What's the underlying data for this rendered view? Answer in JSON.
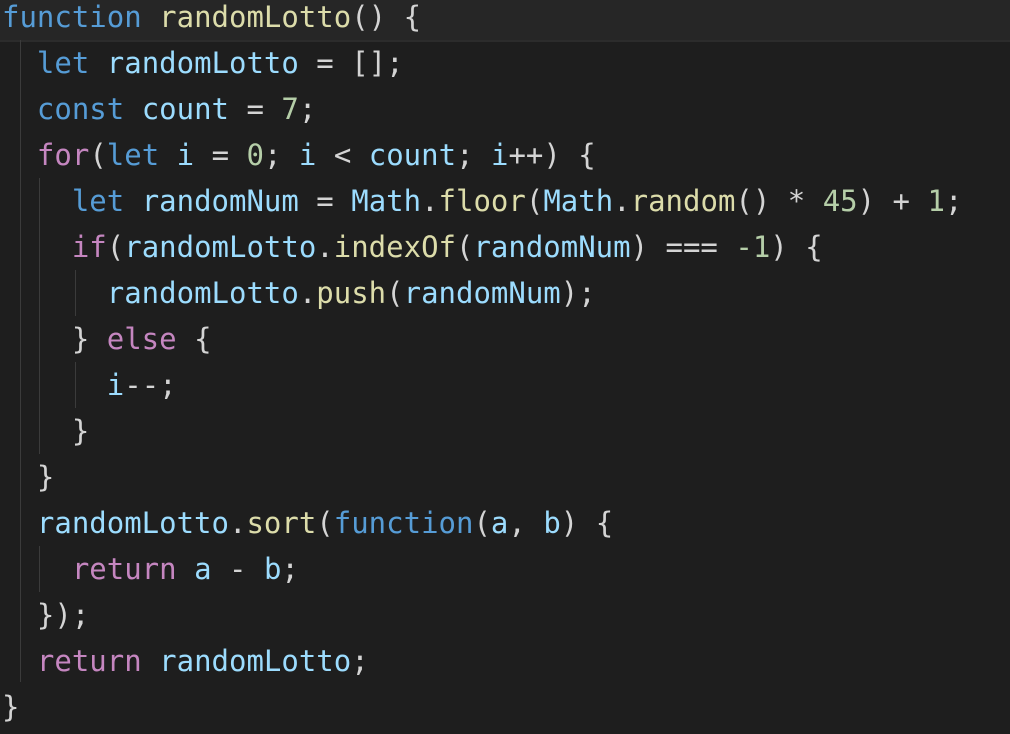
{
  "editor": {
    "language": "javascript",
    "lines": [
      {
        "tokens": [
          {
            "t": "function",
            "c": "kw"
          },
          {
            "t": " ",
            "c": "pun"
          },
          {
            "t": "randomLotto",
            "c": "fn"
          },
          {
            "t": "() {",
            "c": "pun"
          }
        ]
      },
      {
        "tokens": [
          {
            "t": "  ",
            "c": "pun"
          },
          {
            "t": "let",
            "c": "kw"
          },
          {
            "t": " ",
            "c": "pun"
          },
          {
            "t": "randomLotto",
            "c": "var"
          },
          {
            "t": " = [];",
            "c": "pun"
          }
        ]
      },
      {
        "tokens": [
          {
            "t": "  ",
            "c": "pun"
          },
          {
            "t": "const",
            "c": "kw"
          },
          {
            "t": " ",
            "c": "pun"
          },
          {
            "t": "count",
            "c": "var"
          },
          {
            "t": " = ",
            "c": "pun"
          },
          {
            "t": "7",
            "c": "num"
          },
          {
            "t": ";",
            "c": "pun"
          }
        ]
      },
      {
        "tokens": [
          {
            "t": "  ",
            "c": "pun"
          },
          {
            "t": "for",
            "c": "ctl"
          },
          {
            "t": "(",
            "c": "pun"
          },
          {
            "t": "let",
            "c": "kw"
          },
          {
            "t": " ",
            "c": "pun"
          },
          {
            "t": "i",
            "c": "var"
          },
          {
            "t": " = ",
            "c": "pun"
          },
          {
            "t": "0",
            "c": "num"
          },
          {
            "t": "; ",
            "c": "pun"
          },
          {
            "t": "i",
            "c": "var"
          },
          {
            "t": " < ",
            "c": "pun"
          },
          {
            "t": "count",
            "c": "var"
          },
          {
            "t": "; ",
            "c": "pun"
          },
          {
            "t": "i",
            "c": "var"
          },
          {
            "t": "++) {",
            "c": "pun"
          }
        ]
      },
      {
        "tokens": [
          {
            "t": "    ",
            "c": "pun"
          },
          {
            "t": "let",
            "c": "kw"
          },
          {
            "t": " ",
            "c": "pun"
          },
          {
            "t": "randomNum",
            "c": "var"
          },
          {
            "t": " = ",
            "c": "pun"
          },
          {
            "t": "Math",
            "c": "var"
          },
          {
            "t": ".",
            "c": "pun"
          },
          {
            "t": "floor",
            "c": "fn"
          },
          {
            "t": "(",
            "c": "pun"
          },
          {
            "t": "Math",
            "c": "var"
          },
          {
            "t": ".",
            "c": "pun"
          },
          {
            "t": "random",
            "c": "fn"
          },
          {
            "t": "() * ",
            "c": "pun"
          },
          {
            "t": "45",
            "c": "num"
          },
          {
            "t": ") + ",
            "c": "pun"
          },
          {
            "t": "1",
            "c": "num"
          },
          {
            "t": ";",
            "c": "pun"
          }
        ]
      },
      {
        "tokens": [
          {
            "t": "    ",
            "c": "pun"
          },
          {
            "t": "if",
            "c": "ctl"
          },
          {
            "t": "(",
            "c": "pun"
          },
          {
            "t": "randomLotto",
            "c": "var"
          },
          {
            "t": ".",
            "c": "pun"
          },
          {
            "t": "indexOf",
            "c": "fn"
          },
          {
            "t": "(",
            "c": "pun"
          },
          {
            "t": "randomNum",
            "c": "var"
          },
          {
            "t": ") === ",
            "c": "pun"
          },
          {
            "t": "-1",
            "c": "num"
          },
          {
            "t": ") {",
            "c": "pun"
          }
        ]
      },
      {
        "tokens": [
          {
            "t": "      ",
            "c": "pun"
          },
          {
            "t": "randomLotto",
            "c": "var"
          },
          {
            "t": ".",
            "c": "pun"
          },
          {
            "t": "push",
            "c": "fn"
          },
          {
            "t": "(",
            "c": "pun"
          },
          {
            "t": "randomNum",
            "c": "var"
          },
          {
            "t": ");",
            "c": "pun"
          }
        ]
      },
      {
        "tokens": [
          {
            "t": "    } ",
            "c": "pun"
          },
          {
            "t": "else",
            "c": "ctl"
          },
          {
            "t": " {",
            "c": "pun"
          }
        ]
      },
      {
        "tokens": [
          {
            "t": "      ",
            "c": "pun"
          },
          {
            "t": "i",
            "c": "var"
          },
          {
            "t": "--;",
            "c": "pun"
          }
        ]
      },
      {
        "tokens": [
          {
            "t": "    }",
            "c": "pun"
          }
        ]
      },
      {
        "tokens": [
          {
            "t": "  }",
            "c": "pun"
          }
        ]
      },
      {
        "tokens": [
          {
            "t": "  ",
            "c": "pun"
          },
          {
            "t": "randomLotto",
            "c": "var"
          },
          {
            "t": ".",
            "c": "pun"
          },
          {
            "t": "sort",
            "c": "fn"
          },
          {
            "t": "(",
            "c": "pun"
          },
          {
            "t": "function",
            "c": "kw"
          },
          {
            "t": "(",
            "c": "pun"
          },
          {
            "t": "a",
            "c": "var"
          },
          {
            "t": ", ",
            "c": "pun"
          },
          {
            "t": "b",
            "c": "var"
          },
          {
            "t": ") {",
            "c": "pun"
          }
        ]
      },
      {
        "tokens": [
          {
            "t": "    ",
            "c": "pun"
          },
          {
            "t": "return",
            "c": "ctl"
          },
          {
            "t": " ",
            "c": "pun"
          },
          {
            "t": "a",
            "c": "var"
          },
          {
            "t": " - ",
            "c": "pun"
          },
          {
            "t": "b",
            "c": "var"
          },
          {
            "t": ";",
            "c": "pun"
          }
        ]
      },
      {
        "tokens": [
          {
            "t": "  });",
            "c": "pun"
          }
        ]
      },
      {
        "tokens": [
          {
            "t": "  ",
            "c": "pun"
          },
          {
            "t": "return",
            "c": "ctl"
          },
          {
            "t": " ",
            "c": "pun"
          },
          {
            "t": "randomLotto",
            "c": "var"
          },
          {
            "t": ";",
            "c": "pun"
          }
        ]
      },
      {
        "tokens": [
          {
            "t": "}",
            "c": "pun"
          }
        ]
      }
    ]
  }
}
